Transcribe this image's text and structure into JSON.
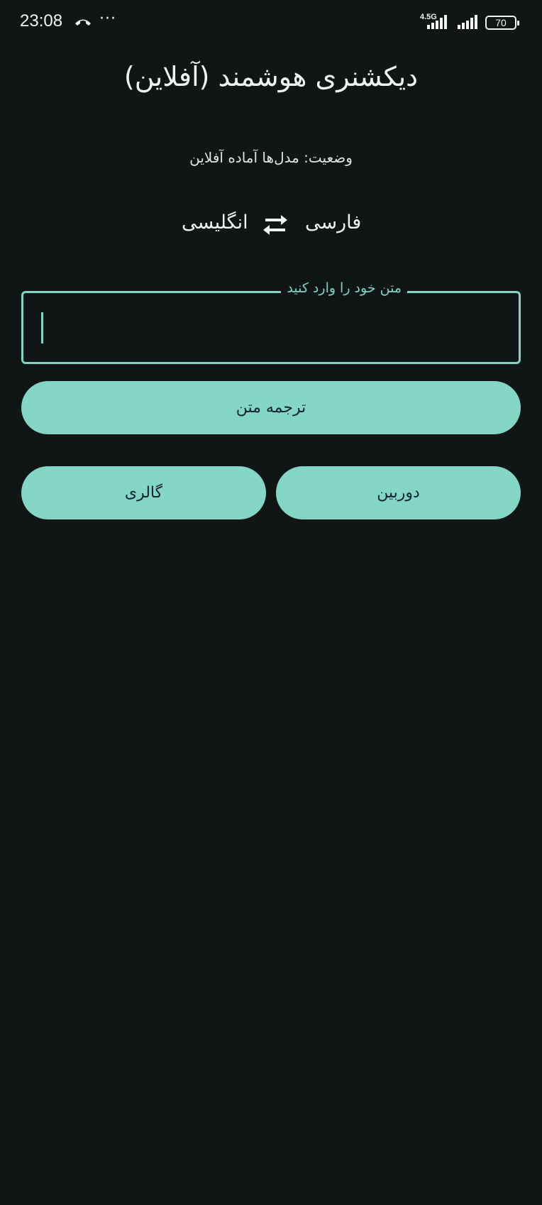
{
  "statusbar": {
    "time": "23:08",
    "dots": "···",
    "network": "4.5G",
    "battery": "70"
  },
  "app": {
    "title": "دیکشنری هوشمند (آفلاین)",
    "status": "وضعیت: مدل‌ها آماده آفلاین"
  },
  "languages": {
    "source": "فارسی",
    "target": "انگلیسی",
    "swap_icon": "swap-horizontal-icon"
  },
  "input": {
    "label": "متن خود را وارد کنید",
    "value": ""
  },
  "buttons": {
    "translate": "ترجمه متن",
    "gallery": "گالری",
    "camera": "دوربین"
  },
  "colors": {
    "background": "#101615",
    "accent": "#82d6c3",
    "text": "#e6ece9"
  }
}
